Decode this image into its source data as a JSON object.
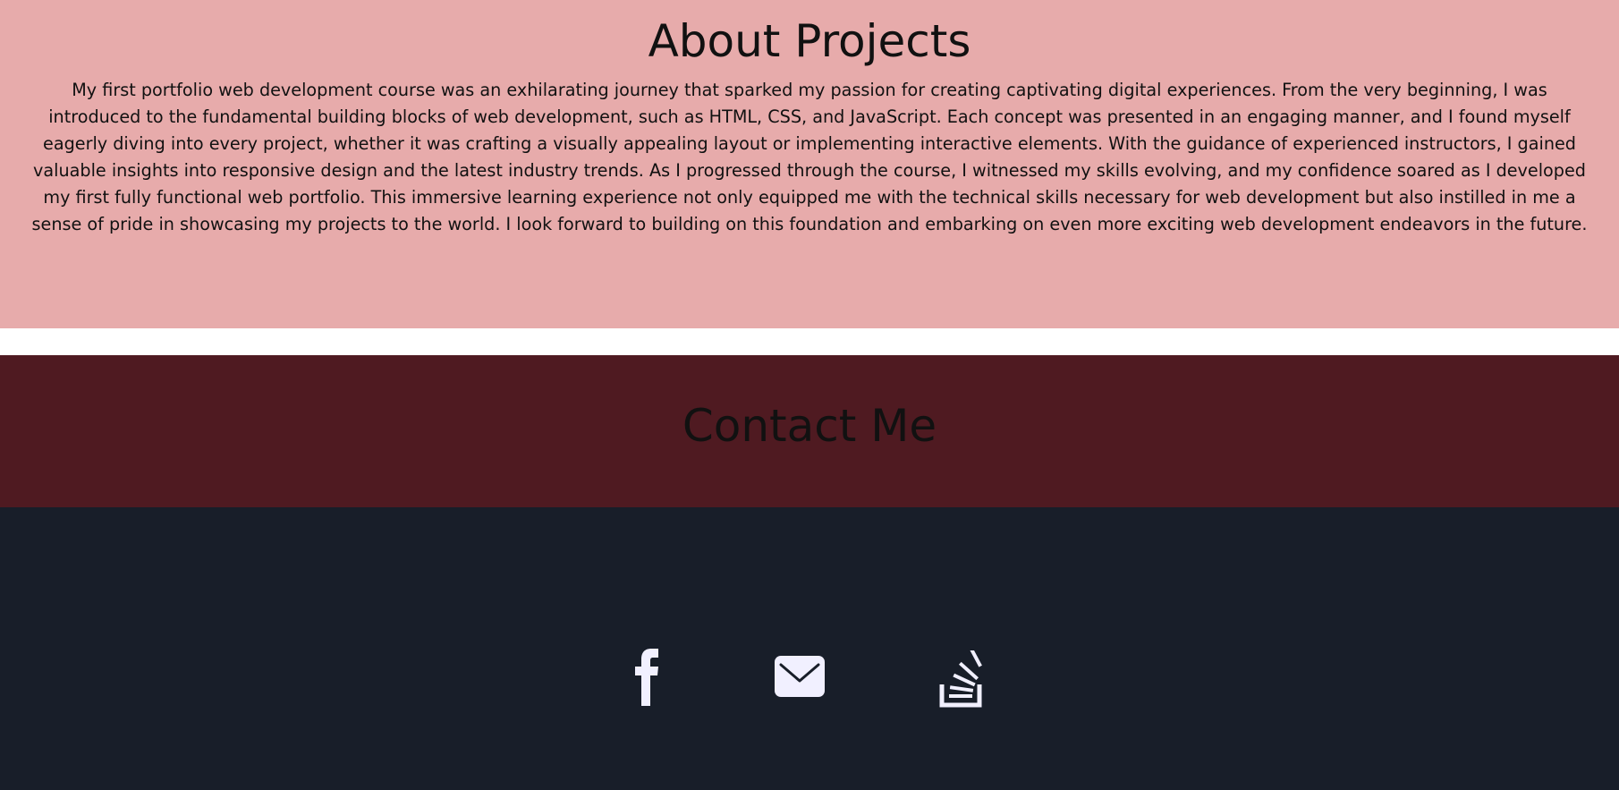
{
  "about": {
    "title": "About Projects",
    "text": "My first portfolio web development course was an exhilarating journey that sparked my passion for creating captivating digital experiences. From the very beginning, I was introduced to the fundamental building blocks of web development, such as HTML, CSS, and JavaScript. Each concept was presented in an engaging manner, and I found myself eagerly diving into every project, whether it was crafting a visually appealing layout or implementing interactive elements. With the guidance of experienced instructors, I gained valuable insights into responsive design and the latest industry trends. As I progressed through the course, I witnessed my skills evolving, and my confidence soared as I developed my first fully functional web portfolio. This immersive learning experience not only equipped me with the technical skills necessary for web development but also instilled in me a sense of pride in showcasing my projects to the world. I look forward to building on this foundation and embarking on even more exciting web development endeavors in the future."
  },
  "contact": {
    "title": "Contact Me"
  },
  "social_links": [
    {
      "icon": "facebook-icon"
    },
    {
      "icon": "envelope-icon"
    },
    {
      "icon": "stack-overflow-icon"
    }
  ],
  "colors": {
    "about_background": "#e7abab",
    "contact_background": "#4f1a21",
    "footer_background": "#181e29",
    "text": "#111111",
    "icon": "#f1f0ff"
  }
}
